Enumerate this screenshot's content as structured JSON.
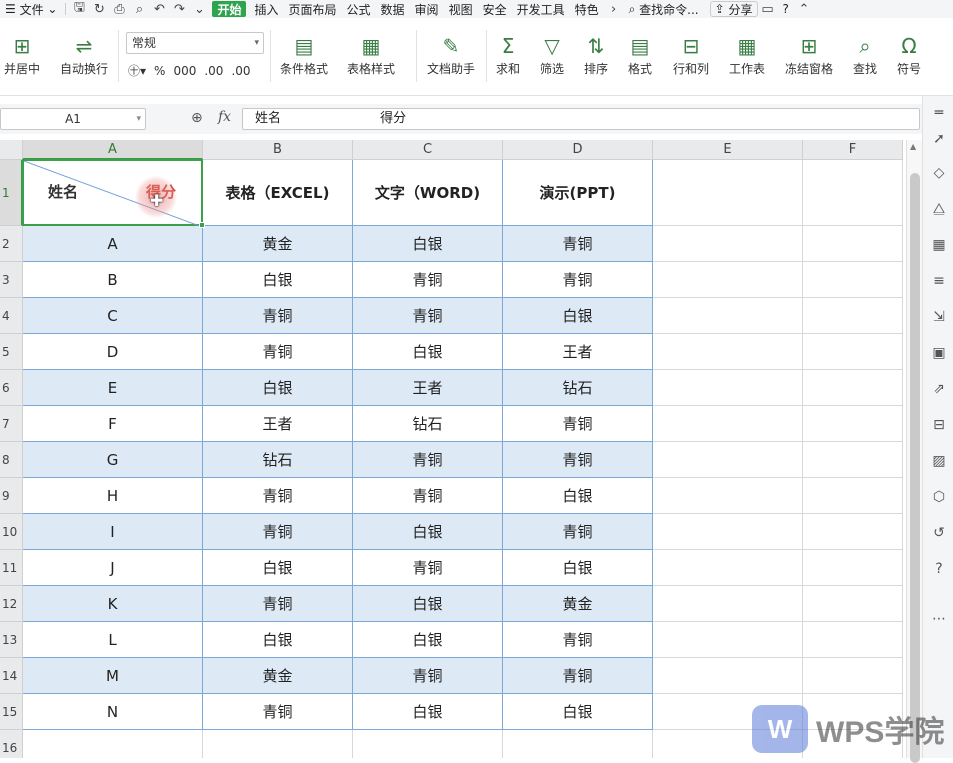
{
  "menubar": {
    "file": "文件",
    "tabs": [
      "开始",
      "插入",
      "页面布局",
      "公式",
      "数据",
      "审阅",
      "视图",
      "安全",
      "开发工具",
      "特色"
    ],
    "active_tab": "开始",
    "search": "查找命令...",
    "share": "分享",
    "help": "?"
  },
  "ribbon": {
    "merge_center": "并居中",
    "wrap_text": "自动换行",
    "number_format": "常规",
    "percent": "%",
    "thousands": "000",
    "dec_inc": ".00",
    "dec_dec": ".00",
    "cond_format": "条件格式",
    "table_style": "表格样式",
    "doc_helper": "文档助手",
    "sum": "求和",
    "filter": "筛选",
    "sort": "排序",
    "format": "格式",
    "row_col": "行和列",
    "worksheet": "工作表",
    "freeze": "冻结窗格",
    "find": "查找",
    "symbol": "符号"
  },
  "formula_bar": {
    "name_box": "A1",
    "fx": "fx",
    "content": "姓名                        得分"
  },
  "sheet": {
    "columns": [
      "A",
      "B",
      "C",
      "D",
      "E",
      "F"
    ],
    "rows": [
      "1",
      "2",
      "3",
      "4",
      "5",
      "6",
      "7",
      "8",
      "9",
      "10",
      "11",
      "12",
      "13",
      "14",
      "15",
      "16"
    ],
    "a1_name": "姓名",
    "a1_score": "得分",
    "headers": [
      "表格（EXCEL)",
      "文字（WORD)",
      "演示(PPT)"
    ],
    "data": [
      [
        "A",
        "黄金",
        "白银",
        "青铜"
      ],
      [
        "B",
        "白银",
        "青铜",
        "青铜"
      ],
      [
        "C",
        "青铜",
        "青铜",
        "白银"
      ],
      [
        "D",
        "青铜",
        "白银",
        "王者"
      ],
      [
        "E",
        "白银",
        "王者",
        "钻石"
      ],
      [
        "F",
        "王者",
        "钻石",
        "青铜"
      ],
      [
        "G",
        "钻石",
        "青铜",
        "青铜"
      ],
      [
        "H",
        "青铜",
        "青铜",
        "白银"
      ],
      [
        "I",
        "青铜",
        "白银",
        "青铜"
      ],
      [
        "J",
        "白银",
        "青铜",
        "白银"
      ],
      [
        "K",
        "青铜",
        "白银",
        "黄金"
      ],
      [
        "L",
        "白银",
        "白银",
        "青铜"
      ],
      [
        "M",
        "黄金",
        "青铜",
        "青铜"
      ],
      [
        "N",
        "青铜",
        "白银",
        "白银"
      ]
    ]
  },
  "watermark": {
    "logo": "W",
    "text": "WPS学院"
  },
  "colors": {
    "accent": "#2ea44f",
    "band": "#ddeaf6",
    "selection": "#3aa04a"
  }
}
